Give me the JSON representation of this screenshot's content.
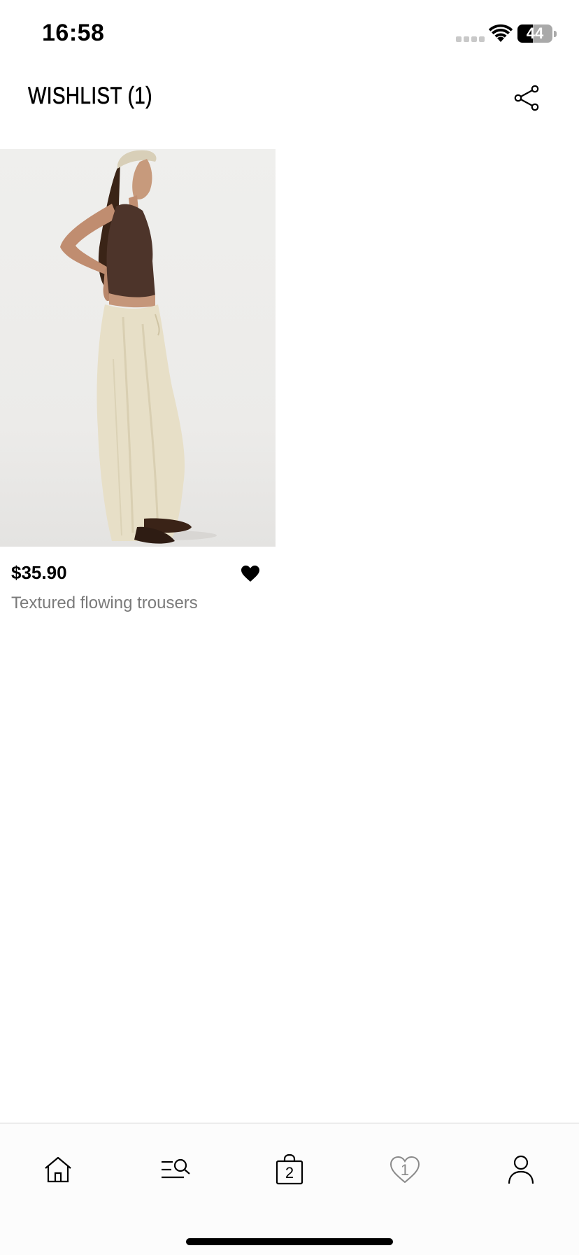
{
  "status_bar": {
    "time": "16:58",
    "battery": "44"
  },
  "header": {
    "title": "WISHLIST (1)",
    "share_icon": "share-icon"
  },
  "wishlist_items": [
    {
      "price": "$35.90",
      "name": "Textured flowing trousers",
      "favorited": true,
      "heart_icon": "heart-filled-icon"
    }
  ],
  "bottom_nav": {
    "items": [
      {
        "icon": "home-icon"
      },
      {
        "icon": "search-menu-icon"
      },
      {
        "icon": "shopping-bag-icon",
        "count": "2"
      },
      {
        "icon": "heart-outline-icon",
        "count": "1"
      },
      {
        "icon": "user-icon"
      }
    ]
  },
  "colors": {
    "background": "#ffffff",
    "text": "#000000",
    "secondary_text": "#7a7a7a",
    "nav_border": "#cfcfcf"
  }
}
